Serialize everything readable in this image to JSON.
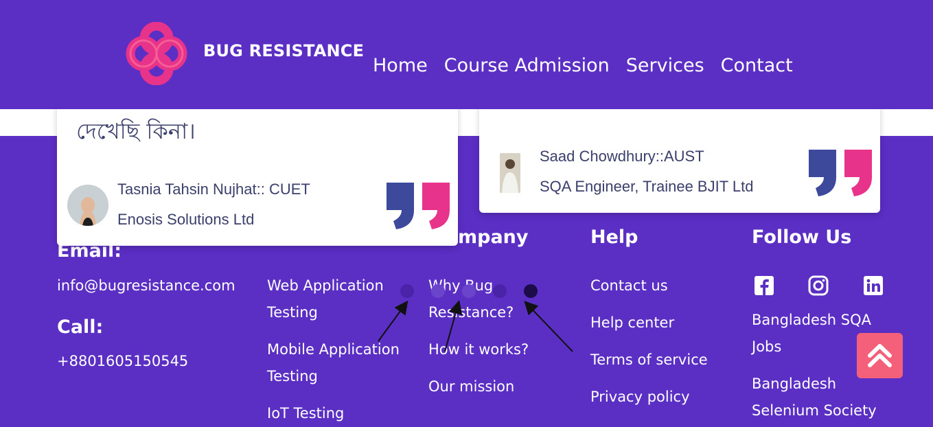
{
  "header": {
    "brand": "BUG RESISTANCE",
    "nav": [
      "Home",
      "Course Admission",
      "Services",
      "Contact"
    ]
  },
  "testimonials": [
    {
      "quote_fragment": "দেখেছি কিনা।",
      "name": "Tasnia Tahsin Nujhat:: CUET",
      "role": "Enosis Solutions Ltd"
    },
    {
      "quote_fragment": "",
      "name": "Saad Chowdhury::AUST",
      "role": "SQA Engineer, Trainee BJIT Ltd"
    }
  ],
  "footer": {
    "email_heading": "Email:",
    "email": "info@bugresistance.com",
    "call_heading": "Call:",
    "phone": "+8801605150545",
    "services": [
      "Web Application",
      "Testing",
      "Mobile Application",
      "Testing",
      "IoT Testing"
    ],
    "company_heading": "mpany",
    "company_links": [
      "Why Bug",
      "Resistance?",
      "How it works?",
      "Our mission"
    ],
    "help_heading": "Help",
    "help_links": [
      "Contact us",
      "Help center",
      "Terms of service",
      "Privacy policy"
    ],
    "follow_heading": "Follow Us",
    "follow_links": [
      "Bangladesh SQA",
      "Jobs",
      "Bangladesh",
      "Selenium Society"
    ]
  },
  "carousel": {
    "dot_count": 5,
    "active_index": 4
  },
  "icons": {
    "social": [
      "facebook-icon",
      "instagram-icon",
      "linkedin-icon"
    ],
    "scroll_top": "double-chevron-up-icon"
  },
  "colors": {
    "background": "#5b2ec4",
    "accent_pink": "#e8338a",
    "quote_blue": "#3d4a9c",
    "scroll_button": "#f4607a"
  }
}
